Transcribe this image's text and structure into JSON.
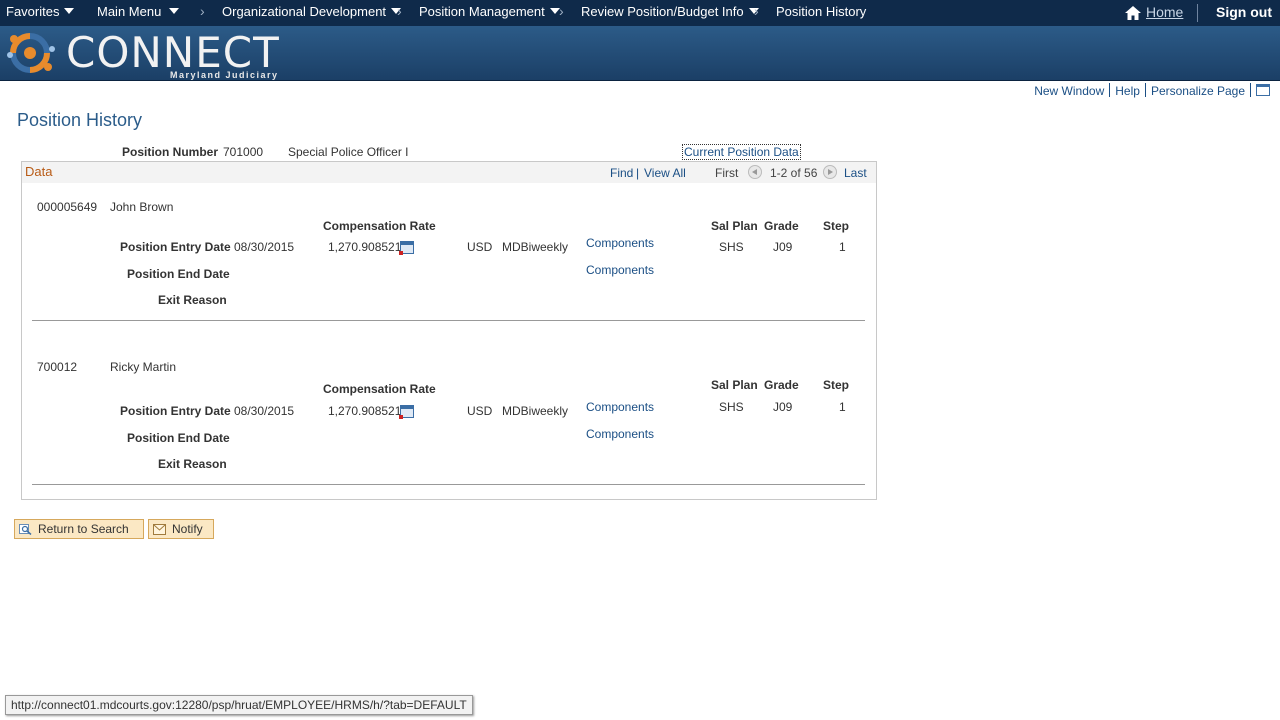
{
  "topnav": {
    "favorites": "Favorites",
    "main_menu": "Main Menu",
    "org_dev": "Organizational Development",
    "position_mgmt": "Position Management",
    "review": "Review Position/Budget Info",
    "current": "Position History",
    "home": "Home",
    "signout": "Sign out"
  },
  "banner": {
    "logo_text": "CONNECT",
    "logo_sub": "Maryland Judiciary"
  },
  "pagelinks": {
    "new_window": "New Window",
    "help": "Help",
    "personalize": "Personalize Page"
  },
  "page": {
    "title": "Position History",
    "position_number_label": "Position Number",
    "position_number": "701000",
    "position_title": "Special Police Officer I",
    "current_data_link": "Current Position Data"
  },
  "data_section": {
    "title": "Data",
    "find": "Find",
    "view_all": "View All",
    "first": "First",
    "range": "1-2 of 56",
    "last": "Last"
  },
  "labels": {
    "comp_rate": "Compensation Rate",
    "entry_date": "Position Entry Date",
    "end_date": "Position End Date",
    "exit_reason": "Exit Reason",
    "sal_plan": "Sal Plan",
    "grade": "Grade",
    "step": "Step",
    "components": "Components"
  },
  "records": [
    {
      "emplid": "000005649",
      "name": "John Brown",
      "entry_date": "08/30/2015",
      "rate": "1,270.908521",
      "currency": "USD",
      "frequency": "MDBiweekly",
      "sal_plan": "SHS",
      "grade": "J09",
      "step": "1"
    },
    {
      "emplid": "700012",
      "name": "Ricky Martin",
      "entry_date": "08/30/2015",
      "rate": "1,270.908521",
      "currency": "USD",
      "frequency": "MDBiweekly",
      "sal_plan": "SHS",
      "grade": "J09",
      "step": "1"
    }
  ],
  "buttons": {
    "return": "Return to Search",
    "notify": "Notify"
  },
  "statusbar": "http://connect01.mdcourts.gov:12280/psp/hruat/EMPLOYEE/HRMS/h/?tab=DEFAULT"
}
